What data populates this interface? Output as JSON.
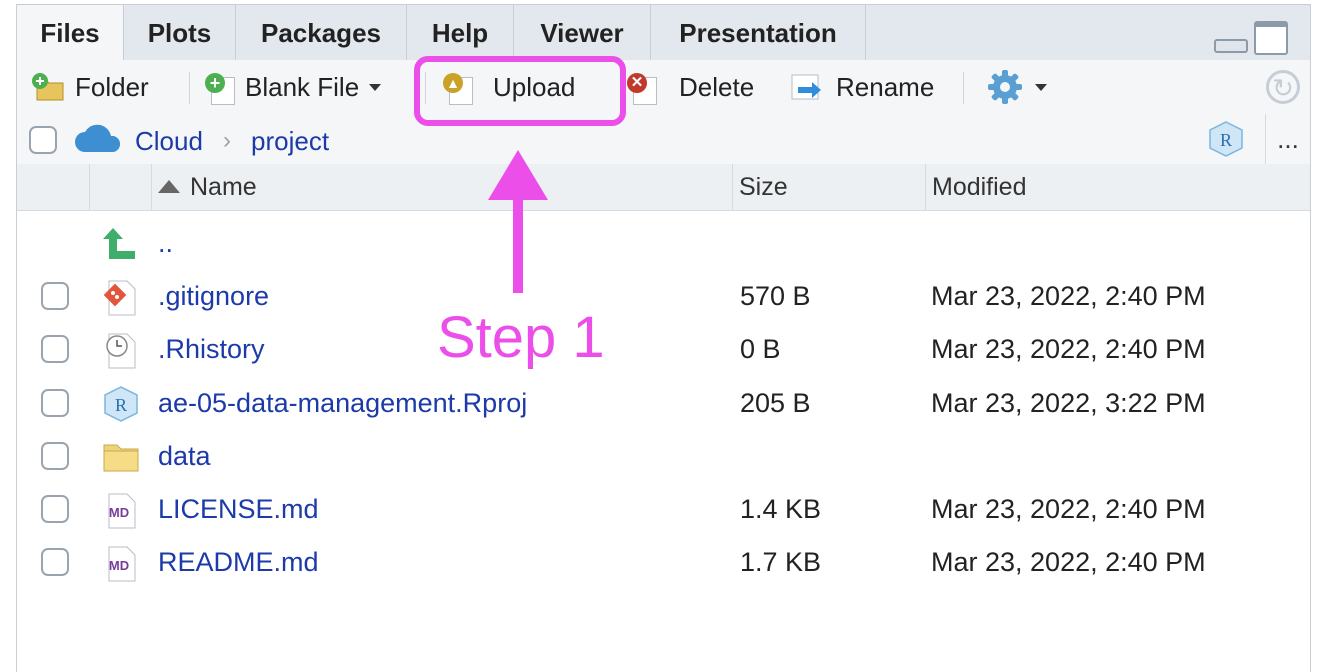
{
  "tabs": [
    {
      "label": "Files",
      "active": true
    },
    {
      "label": "Plots",
      "active": false
    },
    {
      "label": "Packages",
      "active": false
    },
    {
      "label": "Help",
      "active": false
    },
    {
      "label": "Viewer",
      "active": false
    },
    {
      "label": "Presentation",
      "active": false
    }
  ],
  "toolbar": {
    "folder_label": "Folder",
    "blank_file_label": "Blank File",
    "upload_label": "Upload",
    "delete_label": "Delete",
    "rename_label": "Rename"
  },
  "breadcrumb": {
    "root": "Cloud",
    "folder": "project",
    "more": "..."
  },
  "columns": {
    "name": "Name",
    "size": "Size",
    "modified": "Modified"
  },
  "files": [
    {
      "name": "..",
      "size": "",
      "modified": "",
      "icon": "parent-dir-icon"
    },
    {
      "name": ".gitignore",
      "size": "570 B",
      "modified": "Mar 23, 2022, 2:40 PM",
      "icon": "git-file-icon"
    },
    {
      "name": ".Rhistory",
      "size": "0 B",
      "modified": "Mar 23, 2022, 2:40 PM",
      "icon": "history-file-icon"
    },
    {
      "name": "ae-05-data-management.Rproj",
      "size": "205 B",
      "modified": "Mar 23, 2022, 3:22 PM",
      "icon": "rproj-file-icon"
    },
    {
      "name": "data",
      "size": "",
      "modified": "",
      "icon": "folder-icon"
    },
    {
      "name": "LICENSE.md",
      "size": "1.4 KB",
      "modified": "Mar 23, 2022, 2:40 PM",
      "icon": "markdown-file-icon"
    },
    {
      "name": "README.md",
      "size": "1.7 KB",
      "modified": "Mar 23, 2022, 2:40 PM",
      "icon": "markdown-file-icon"
    }
  ],
  "annotation": {
    "label": "Step 1",
    "color": "#ec4fe9"
  },
  "colors": {
    "link": "#1c3aa9",
    "tab_bg": "#e3e8ee",
    "toolbar_bg": "#f4f6f8"
  }
}
